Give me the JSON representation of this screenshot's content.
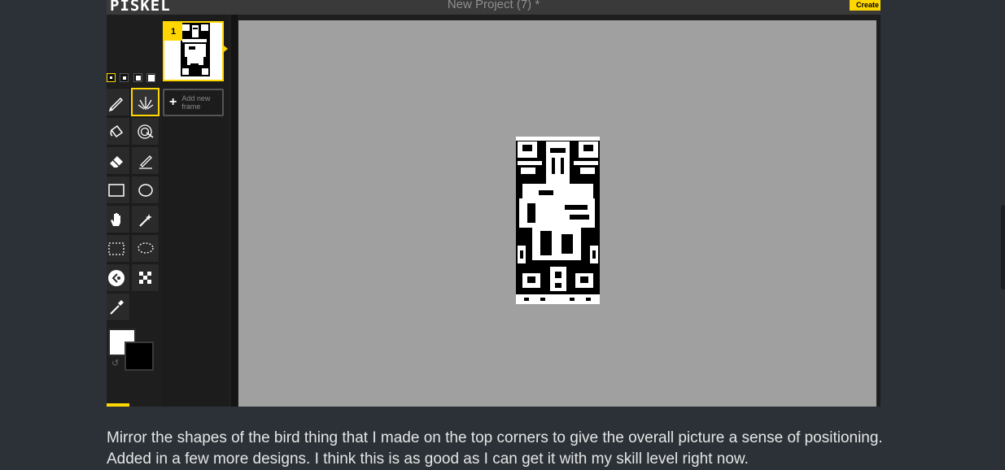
{
  "app": {
    "logo": "PISKEL",
    "title": "New Project (7) *",
    "create_label": "Create"
  },
  "tools": [
    {
      "name": "pen-tool",
      "selected": false
    },
    {
      "name": "vertical-mirror-pen-tool",
      "selected": true
    },
    {
      "name": "paint-bucket-tool",
      "selected": false
    },
    {
      "name": "paint-all-same-color-tool",
      "selected": false
    },
    {
      "name": "eraser-tool",
      "selected": false
    },
    {
      "name": "stroke-tool",
      "selected": false
    },
    {
      "name": "rectangle-tool",
      "selected": false
    },
    {
      "name": "circle-tool",
      "selected": false
    },
    {
      "name": "move-tool",
      "selected": false
    },
    {
      "name": "shape-selection-tool",
      "selected": false
    },
    {
      "name": "rectangle-selection-tool",
      "selected": false
    },
    {
      "name": "lasso-selection-tool",
      "selected": false
    },
    {
      "name": "lighten-tool",
      "selected": false
    },
    {
      "name": "dithering-tool",
      "selected": false
    },
    {
      "name": "color-picker-tool",
      "selected": false
    }
  ],
  "pen_sizes": {
    "count": 4,
    "selected_index": 0
  },
  "colors": {
    "primary": "#ffffff",
    "secondary": "#000000",
    "accent": "#ffd700",
    "canvas_bg": "#a0a0a0",
    "page_bg": "#2b3137"
  },
  "frames": {
    "items": [
      {
        "number": "1",
        "selected": true
      }
    ],
    "add_label": "Add new frame"
  },
  "caption": {
    "text": "Mirror the shapes of the bird thing that I made on the top corners to give the overall picture a sense of positioning. Added in a few more designs. I think this is as good as I can get it with my skill level right now."
  }
}
